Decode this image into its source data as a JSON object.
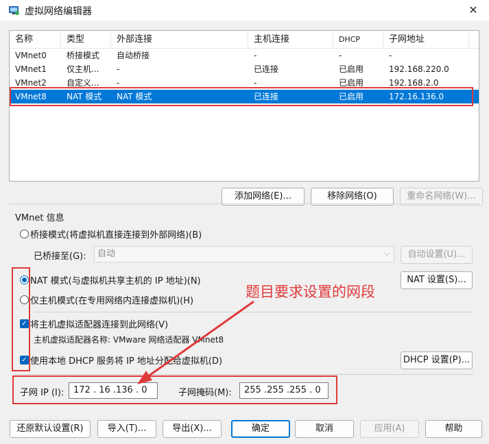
{
  "window": {
    "title": "虚拟网络编辑器",
    "close_glyph": "✕"
  },
  "list": {
    "columns": [
      "名称",
      "类型",
      "外部连接",
      "主机连接",
      "DHCP",
      "子网地址"
    ],
    "rows": [
      {
        "name": "VMnet0",
        "type": "桥接模式",
        "external": "自动桥接",
        "host": "-",
        "dhcp": "-",
        "subnet": "-"
      },
      {
        "name": "VMnet1",
        "type": "仅主机...",
        "external": "-",
        "host": "已连接",
        "dhcp": "已启用",
        "subnet": "192.168.220.0"
      },
      {
        "name": "VMnet2",
        "type": "自定义...",
        "external": "-",
        "host": "-",
        "dhcp": "已启用",
        "subnet": "192.168.2.0"
      },
      {
        "name": "VMnet8",
        "type": "NAT 模式",
        "external": "NAT 模式",
        "host": "已连接",
        "dhcp": "已启用",
        "subnet": "172.16.136.0"
      }
    ],
    "selected_index": 3
  },
  "list_buttons": {
    "add": "添加网络(E)...",
    "remove": "移除网络(O)",
    "rename": "重命名网络(W)..."
  },
  "vmnet_info": {
    "label": "VMnet 信息",
    "bridged_radio": "桥接模式(将虚拟机直接连接到外部网络)(B)",
    "bridged_to_label": "已桥接至(G):",
    "bridged_to_value": "自动",
    "auto_settings": "自动设置(U)...",
    "nat_radio": "NAT 模式(与虚拟机共享主机的 IP 地址)(N)",
    "nat_settings": "NAT 设置(S)...",
    "hostonly_radio": "仅主机模式(在专用网络内连接虚拟机)(H)",
    "connect_adapter_check": "将主机虚拟适配器连接到此网络(V)",
    "adapter_name": "主机虚拟适配器名称: VMware 网络适配器 VMnet8",
    "dhcp_check": "使用本地 DHCP 服务将 IP 地址分配给虚拟机(D)",
    "dhcp_settings": "DHCP 设置(P)...",
    "subnet_ip_label": "子网 IP (I):",
    "subnet_ip_value": "172 . 16 .136 .  0",
    "subnet_mask_label": "子网掩码(M):",
    "subnet_mask_value": "255 .255 .255 .  0"
  },
  "bottom_buttons": {
    "restore": "还原默认设置(R)",
    "import": "导入(T)...",
    "export": "导出(X)...",
    "ok": "确定",
    "cancel": "取消",
    "apply": "应用(A)",
    "help": "帮助"
  },
  "annotation": {
    "text": "题目要求设置的网段",
    "color": "#e0393a"
  },
  "colors": {
    "selection": "#0078d7",
    "accent": "#0067c0",
    "annotation": "#e0393a"
  }
}
